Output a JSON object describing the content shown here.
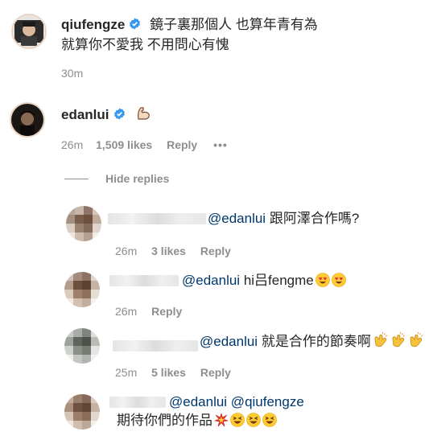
{
  "post": {
    "username": "qiufengze",
    "caption_line1": "鏡子裏那個人 也算年青有為",
    "caption_line2": "就算你不愛我 不用問心有愧",
    "time": "30m"
  },
  "top_comment": {
    "username": "edanlui",
    "emoji": "flexed-biceps",
    "time": "26m",
    "likes": "1,509 likes",
    "reply": "Reply",
    "more": "•••"
  },
  "hide_replies": "Hide replies",
  "replies": [
    {
      "mention": "@edanlui",
      "text": " 跟阿澤合作嗎?",
      "time": "26m",
      "likes": "3 likes",
      "reply": "Reply"
    },
    {
      "mention": "@edanlui",
      "text": " hi吕fengme",
      "emojis": [
        "heart-eyes",
        "heart-eyes"
      ],
      "time": "26m",
      "reply": "Reply"
    },
    {
      "mention": "@edanlui",
      "text": " 就是合作的節奏啊",
      "emojis": [
        "clapping-hands",
        "clapping-hands",
        "clapping-hands"
      ],
      "time": "25m",
      "likes": "5 likes",
      "reply": "Reply"
    },
    {
      "mention": "@edanlui @qiufengze",
      "text": "期待你們的作品",
      "emojis": [
        "collision",
        "laughing",
        "laughing",
        "laughing"
      ]
    }
  ],
  "colors": {
    "mention": "#00376b",
    "meta": "#8e8e8e",
    "verified": "#3897f0"
  }
}
